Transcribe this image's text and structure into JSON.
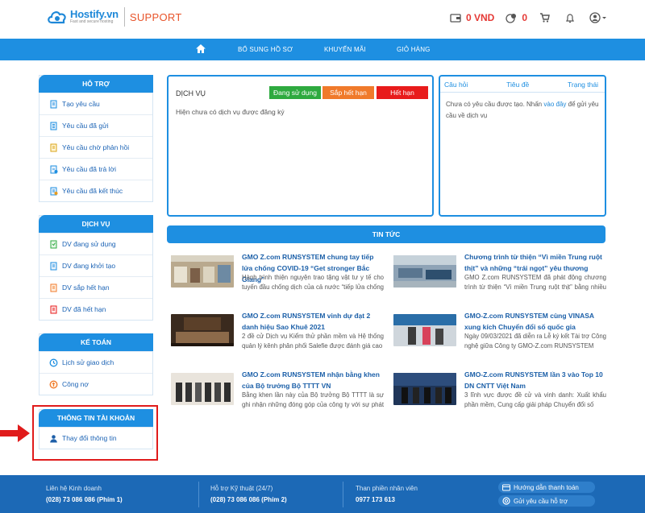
{
  "header": {
    "brand": "Hostify.vn",
    "tagline": "Fast and secure hosting",
    "section": "SUPPORT",
    "balance": "0 VND",
    "points": "0"
  },
  "nav": {
    "items": [
      "BỔ SUNG HỒ SƠ",
      "KHUYẾN MÃI",
      "GIỎ HÀNG"
    ]
  },
  "sidebar": {
    "support": {
      "title": "HỖ TRỢ",
      "items": [
        "Tạo yêu cầu",
        "Yêu cầu đã gửi",
        "Yêu cầu chờ phản hồi",
        "Yêu cầu đã trả lời",
        "Yêu cầu đã kết thúc"
      ]
    },
    "services": {
      "title": "DỊCH VỤ",
      "items": [
        "DV đang sử dụng",
        "DV đang khởi tạo",
        "DV sắp hết hạn",
        "DV đã hết hạn"
      ]
    },
    "accounting": {
      "title": "KẾ TOÁN",
      "items": [
        "Lịch sử giao dịch",
        "Công nợ"
      ]
    },
    "account": {
      "title": "THÔNG TIN TÀI KHOẢN",
      "items": [
        "Thay đổi thông tin"
      ]
    }
  },
  "service_panel": {
    "title": "DỊCH VỤ",
    "buttons": [
      "Đang sử dụng",
      "Sắp hết hạn",
      "Hết hạn"
    ],
    "empty_text": "Hiện chưa có dịch vụ được đăng ký"
  },
  "questions_panel": {
    "columns": [
      "Câu hỏi",
      "Tiêu đề",
      "Trạng thái"
    ],
    "text_before": "Chưa có yêu cầu được tạo. Nhấn",
    "link": "vào đây",
    "text_after": "để gửi yêu cầu về dịch vụ"
  },
  "news": {
    "title": "TIN TỨC",
    "items": [
      {
        "title": "GMO Z.com RUNSYSTEM chung tay tiếp lửa chống COVID-19 “Get stronger Bắc Giang”",
        "desc": "Hành trình thiện nguyện trao tặng vật tư y tế cho tuyến đầu chống dịch của cả nước “tiếp lửa chống COVID-19”"
      },
      {
        "title": "Chương trình từ thiện “Vì miền Trung ruột thịt” và những “trái ngọt” yêu thương",
        "desc": "GMO Z.com RUNSYSTEM đã phát động chương trình từ thiện “Vì miền Trung ruột thịt” bằng nhiều hoạt động"
      },
      {
        "title": "GMO Z.com RUNSYSTEM vinh dự đạt 2 danh hiệu Sao Khuê 2021",
        "desc": "2 đề cử Dịch vụ Kiểm thử phần mềm và Hệ thống quản lý kênh phân phối Salefie được đánh giá cao"
      },
      {
        "title": "GMO-Z.com RUNSYSTEM cùng VINASA xung kích Chuyển đổi số quốc gia",
        "desc": "Ngày 09/03/2021 đã diễn ra Lễ ký kết Tài trợ Công nghệ giữa Công ty GMO-Z.com RUNSYSTEM"
      },
      {
        "title": "GMO Z.com RUNSYSTEM nhận bằng khen của Bộ trưởng Bộ TTTT VN",
        "desc": "Bằng khen lần này của Bộ trưởng Bộ TTTT là sự ghi nhận những đóng góp của công ty với sự phát triển"
      },
      {
        "title": "GMO-Z.com RUNSYSTEM lần 3 vào Top 10 DN CNTT Việt Nam",
        "desc": "3 lĩnh vực được đề cử và vinh danh: Xuất khẩu phần mềm, Cung cấp giải pháp Chuyển đổi số"
      }
    ]
  },
  "footer": {
    "business_label": "Liên hệ Kinh doanh",
    "business_phone": "(028) 73 086 086 (Phím 1)",
    "tech_label": "Hỗ trợ Kỹ thuật (24/7)",
    "tech_phone": "(028) 73 086 086 (Phím 2)",
    "complaint_label": "Than phiền nhân viên",
    "complaint_phone": "0977 173 613",
    "payment_guide": "Hướng dẫn thanh toán",
    "send_support": "Gửi yêu cầu hỗ trợ"
  },
  "colors": {
    "primary": "#1e8fe1",
    "green": "#2eaa3f",
    "orange": "#f07a2b",
    "red": "#e81b1b",
    "footer": "#1c69b6"
  }
}
